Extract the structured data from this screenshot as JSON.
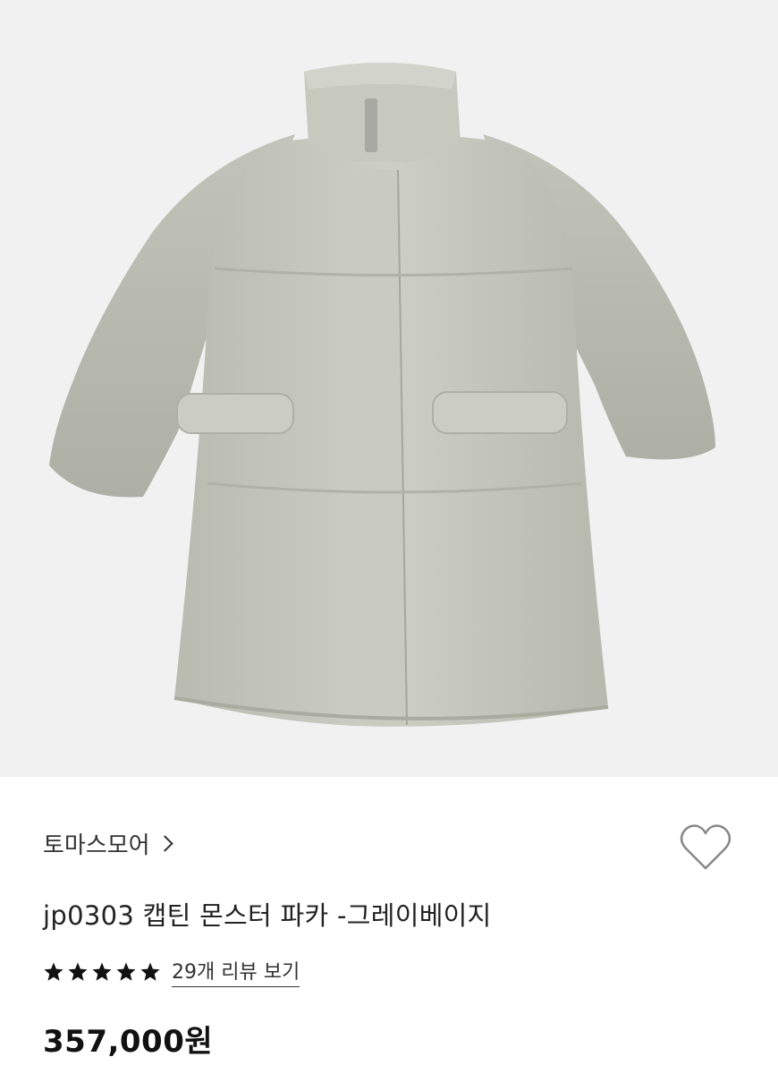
{
  "product": {
    "image_alt_icon": "puffer-parka-image",
    "brand": "토마스모어",
    "title": "jp0303 캡틴 몬스터 파카 -그레이베이지",
    "rating": 5,
    "rating_max": 5,
    "review_link": "29개 리뷰 보기",
    "price": "357,000원"
  },
  "colors": {
    "background": "#f1f1f1",
    "coat": "#c4c5bb",
    "coat_shadow": "#a9ab9f",
    "star": "#111111"
  },
  "icons": {
    "wishlist": "heart-outline-icon",
    "brand_arrow": "chevron-right-icon",
    "star": "star-icon"
  }
}
